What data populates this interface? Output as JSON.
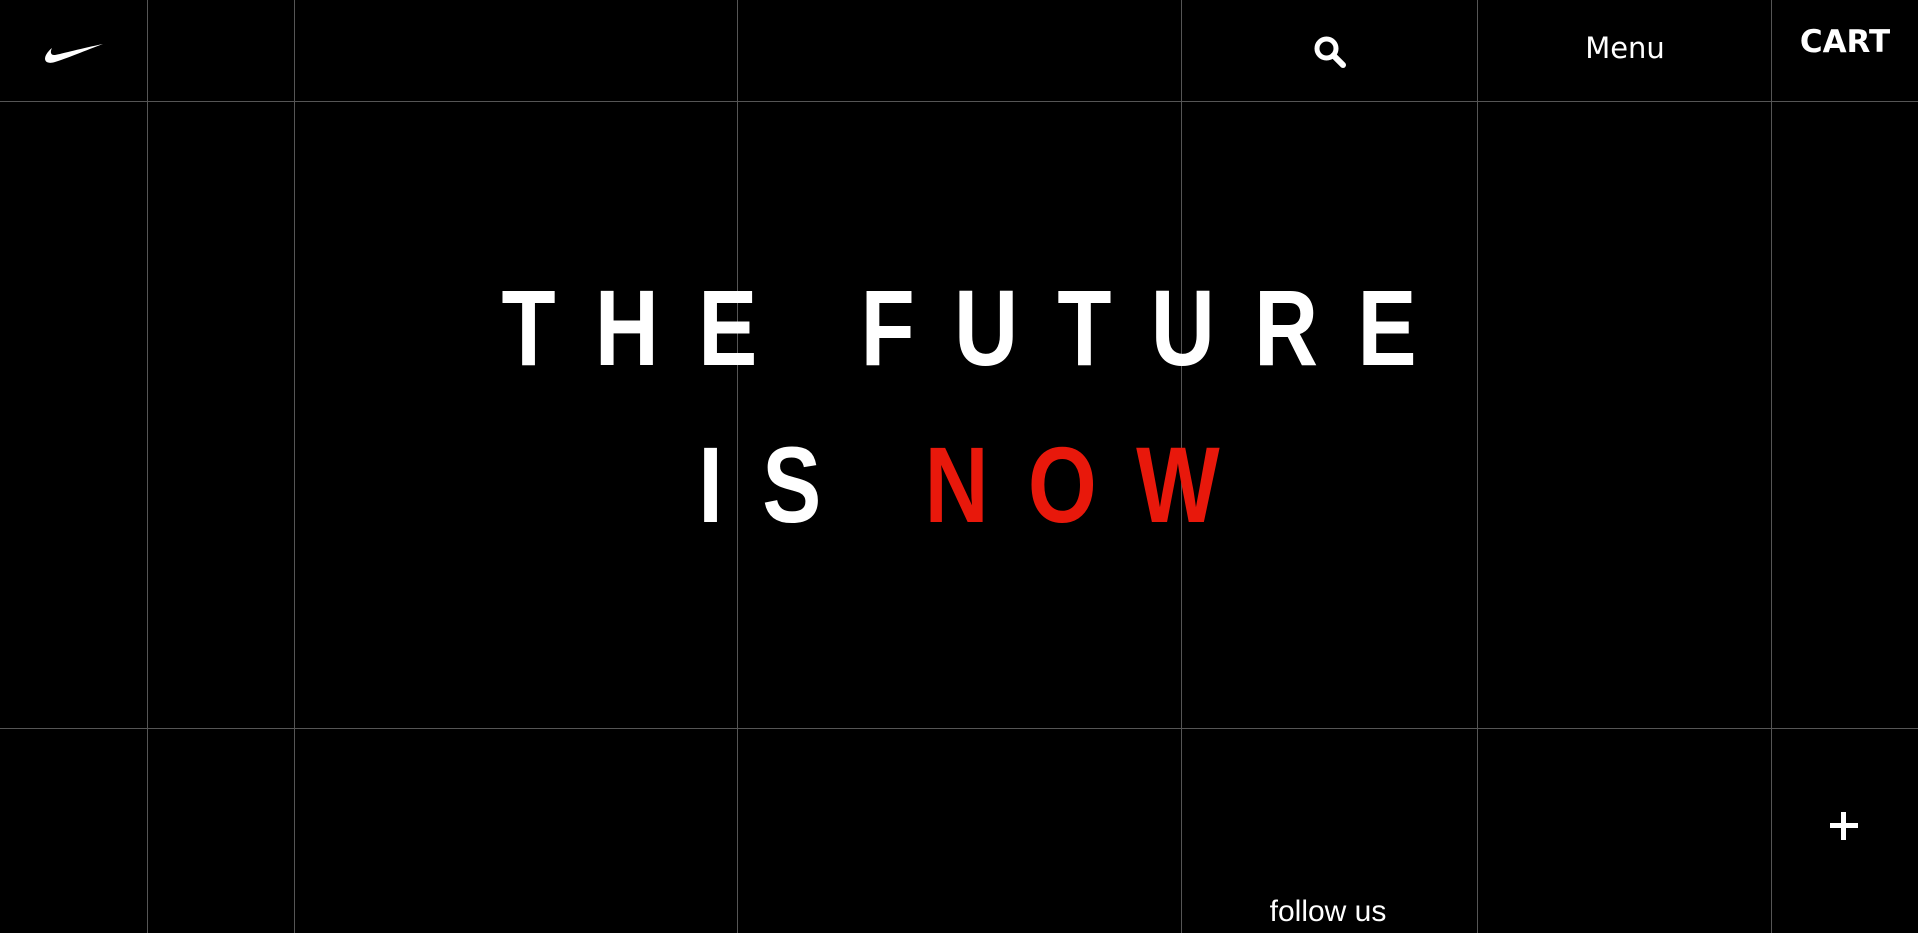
{
  "header": {
    "logo_icon": "swoosh-icon",
    "search_icon": "search-icon",
    "menu_label": "Menu",
    "cart_label": "CART"
  },
  "hero": {
    "line1": "THE FUTURE",
    "line2_prefix": "IS ",
    "line2_accent": "NOW",
    "accent_color": "#e8180b"
  },
  "footer": {
    "plus_icon": "plus-icon",
    "follow_label": "follow us"
  },
  "colors": {
    "background": "#000000",
    "text": "#ffffff",
    "grid": "#555555"
  }
}
